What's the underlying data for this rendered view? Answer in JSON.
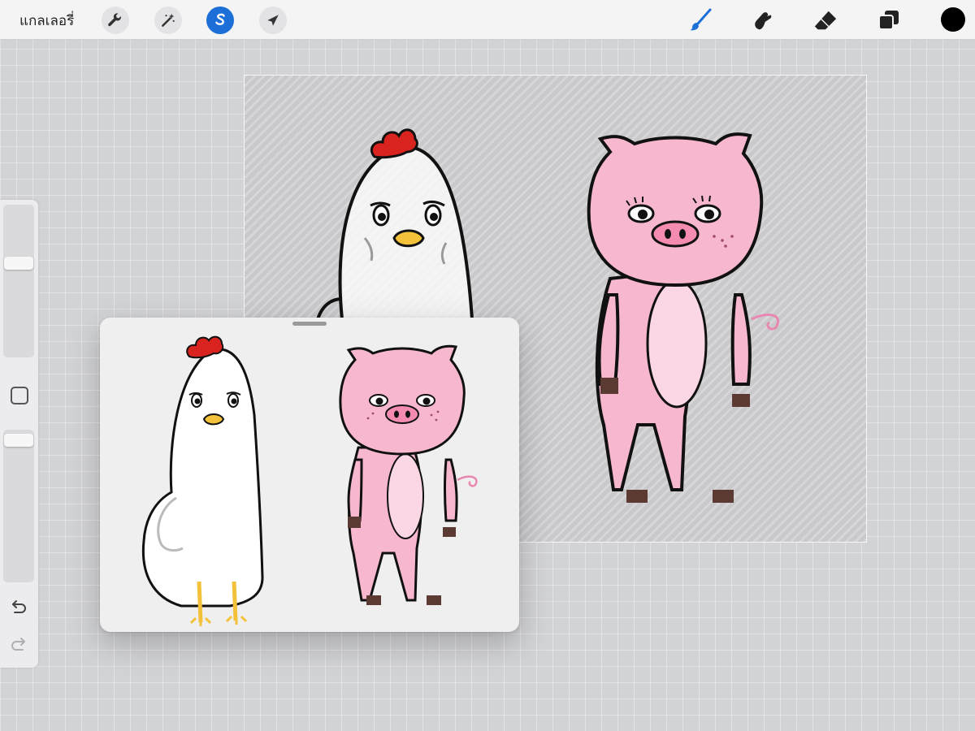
{
  "toolbar": {
    "gallery_label": "แกลเลอรี่",
    "left_tools": [
      {
        "icon": "wrench-icon",
        "name": "actions"
      },
      {
        "icon": "magic-wand-icon",
        "name": "adjustments"
      },
      {
        "icon": "selection-s-icon",
        "name": "selection",
        "active": true
      },
      {
        "icon": "arrow-cursor-icon",
        "name": "transform"
      }
    ],
    "right_tools": [
      {
        "icon": "brush-icon",
        "name": "paint",
        "active": true
      },
      {
        "icon": "smudge-icon",
        "name": "smudge"
      },
      {
        "icon": "eraser-icon",
        "name": "erase"
      },
      {
        "icon": "layers-icon",
        "name": "layers"
      }
    ],
    "current_color": "#000000"
  },
  "sidebar": {
    "brush_size_level": 0.63,
    "opacity_level": 0.98,
    "undo_icon": "undo-icon",
    "redo_icon": "redo-icon"
  },
  "colors": {
    "accent": "#1b6fd6",
    "pig_pink": "#f6b7cf",
    "chicken_comb": "#d8231f",
    "beak": "#f3c23a"
  }
}
